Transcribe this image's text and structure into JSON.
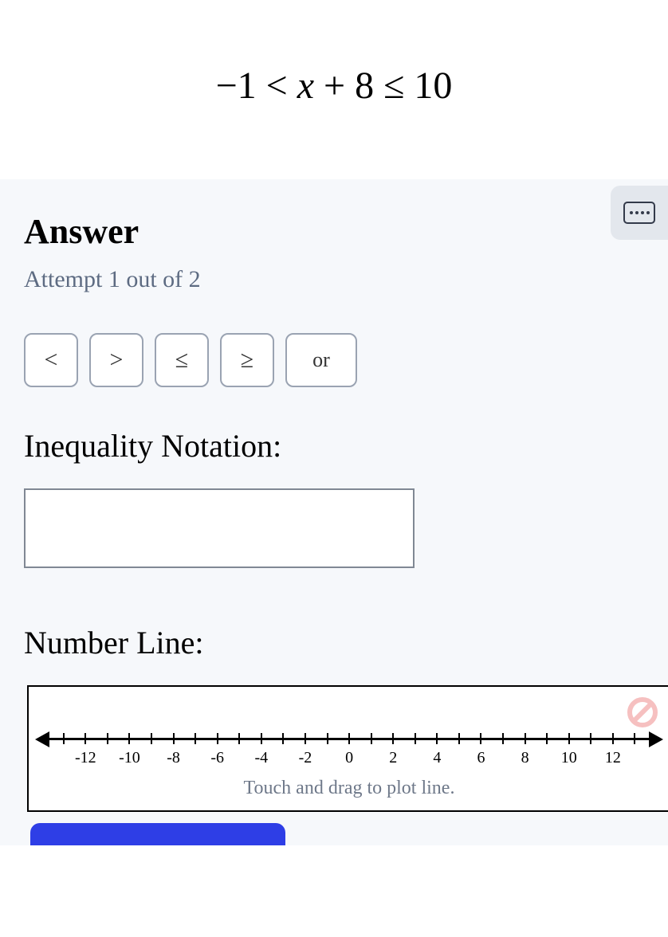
{
  "question": {
    "display": "−1 < x + 8 ≤ 10"
  },
  "answer": {
    "heading": "Answer",
    "attempt": "Attempt 1 out of 2"
  },
  "operators": {
    "lt": "<",
    "gt": ">",
    "le": "≤",
    "ge": "≥",
    "or": "or"
  },
  "sections": {
    "notation_label": "Inequality Notation:",
    "numberline_label": "Number Line:"
  },
  "notation_input": {
    "value": ""
  },
  "numberline": {
    "ticks": [
      "",
      "-12",
      "",
      "-10",
      "",
      "-8",
      "",
      "-6",
      "",
      "-4",
      "",
      "-2",
      "",
      "0",
      "",
      "2",
      "",
      "4",
      "",
      "6",
      "",
      "8",
      "",
      "10",
      "",
      "12",
      ""
    ],
    "hint": "Touch and drag to plot line."
  }
}
